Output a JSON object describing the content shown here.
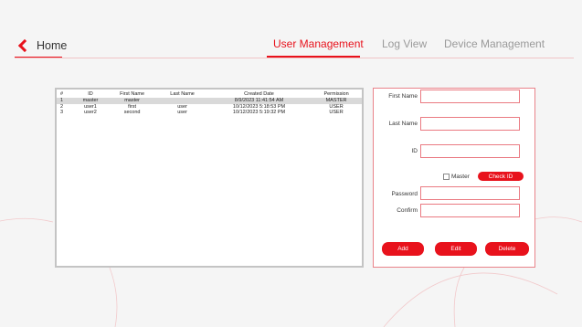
{
  "nav": {
    "home_label": "Home",
    "tabs": [
      {
        "label": "User Management",
        "active": true
      },
      {
        "label": "Log View",
        "active": false
      },
      {
        "label": "Device Management",
        "active": false
      }
    ]
  },
  "table": {
    "headers": [
      "#",
      "ID",
      "First Name",
      "Last Name",
      "Created Date",
      "Permission"
    ],
    "rows": [
      {
        "num": "1",
        "id": "master",
        "first": "master",
        "last": "",
        "created": "8/9/2023 11:41:54 AM",
        "permission": "MASTER",
        "selected": true
      },
      {
        "num": "2",
        "id": "user1",
        "first": "first",
        "last": "user",
        "created": "10/12/2023 5:18:53 PM",
        "permission": "USER",
        "selected": false
      },
      {
        "num": "3",
        "id": "user2",
        "first": "second",
        "last": "user",
        "created": "10/12/2023 5:19:32 PM",
        "permission": "USER",
        "selected": false
      }
    ]
  },
  "form": {
    "first_name_label": "First Name",
    "first_name_value": "",
    "last_name_label": "Last Name",
    "last_name_value": "",
    "id_label": "ID",
    "id_value": "",
    "master_label": "Master",
    "master_checked": false,
    "check_id_label": "Check ID",
    "password_label": "Password",
    "password_value": "",
    "confirm_label": "Confirm",
    "confirm_value": "",
    "add_label": "Add",
    "edit_label": "Edit",
    "delete_label": "Delete"
  },
  "colors": {
    "accent": "#e8121c",
    "input_border": "#ea7a82",
    "panel_border": "#e9838a",
    "background": "#f5f5f5",
    "tab_inactive": "#9a9a9a"
  }
}
